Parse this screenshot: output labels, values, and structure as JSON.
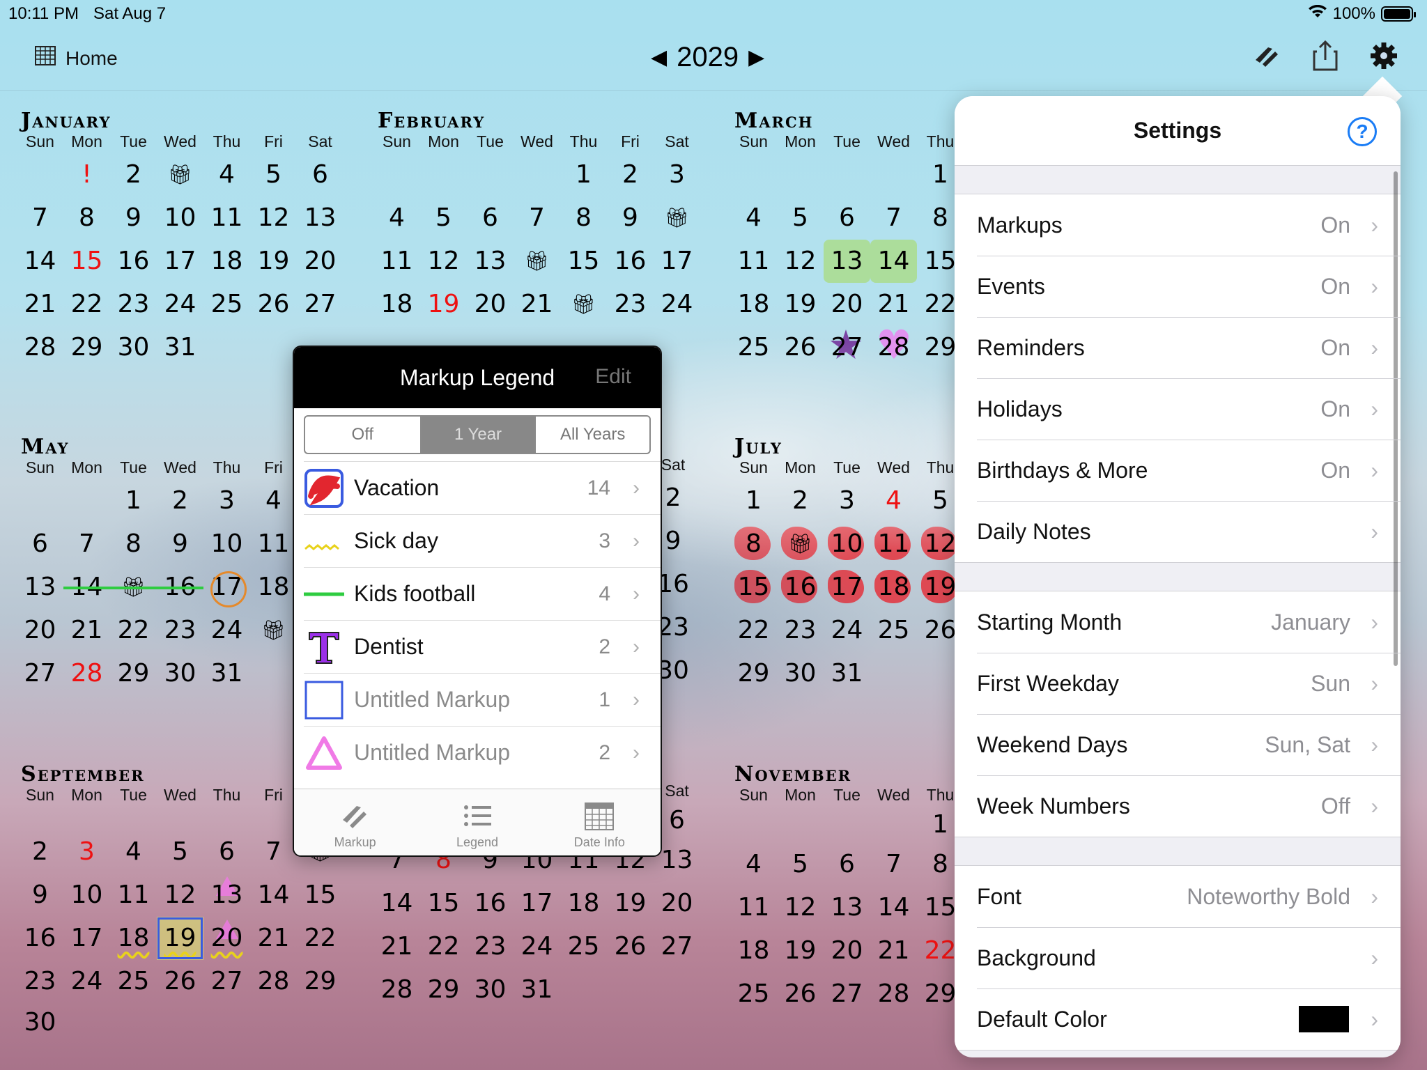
{
  "status": {
    "time": "10:11 PM",
    "date": "Sat Aug 7",
    "battery": "100%"
  },
  "nav": {
    "home_label": "Home",
    "year": "2029",
    "prev_arrow": "◀",
    "next_arrow": "▶",
    "icons": [
      "markup-pen-icon",
      "share-icon",
      "gear-icon"
    ]
  },
  "weekdays": [
    "Sun",
    "Mon",
    "Tue",
    "Wed",
    "Thu",
    "Fri",
    "Sat"
  ],
  "months": {
    "january": {
      "title": "January"
    },
    "february": {
      "title": "February"
    },
    "march": {
      "title": "March"
    },
    "may": {
      "title": "May"
    },
    "july": {
      "title": "July"
    },
    "september": {
      "title": "September"
    },
    "november": {
      "title": "November"
    }
  },
  "legend": {
    "title": "Markup Legend",
    "edit_label": "Edit",
    "segments": [
      "Off",
      "1 Year",
      "All Years"
    ],
    "selected_segment": "1 Year",
    "items": [
      {
        "label": "Vacation",
        "count": "14",
        "icon": "red-scribble-icon"
      },
      {
        "label": "Sick day",
        "count": "3",
        "icon": "yellow-wavy-line-icon"
      },
      {
        "label": "Kids football",
        "count": "4",
        "icon": "green-line-icon"
      },
      {
        "label": "Dentist",
        "count": "2",
        "icon": "purple-t-icon"
      },
      {
        "label": "Untitled Markup",
        "count": "1",
        "icon": "blue-square-icon"
      },
      {
        "label": "Untitled Markup",
        "count": "2",
        "icon": "pink-triangle-icon"
      }
    ],
    "tabs": [
      "Markup",
      "Legend",
      "Date Info"
    ]
  },
  "settings": {
    "title": "Settings",
    "help_label": "?",
    "group1": [
      {
        "label": "Markups",
        "value": "On"
      },
      {
        "label": "Events",
        "value": "On"
      },
      {
        "label": "Reminders",
        "value": "On"
      },
      {
        "label": "Holidays",
        "value": "On"
      },
      {
        "label": "Birthdays & More",
        "value": "On"
      },
      {
        "label": "Daily Notes",
        "value": ""
      }
    ],
    "group2": [
      {
        "label": "Starting Month",
        "value": "January"
      },
      {
        "label": "First Weekday",
        "value": "Sun"
      },
      {
        "label": "Weekend Days",
        "value": "Sun, Sat"
      },
      {
        "label": "Week Numbers",
        "value": "Off"
      }
    ],
    "group3": [
      {
        "label": "Font",
        "value": "Noteworthy Bold"
      },
      {
        "label": "Background",
        "value": ""
      },
      {
        "label": "Default Color",
        "value": "",
        "color": "#000000"
      }
    ]
  }
}
